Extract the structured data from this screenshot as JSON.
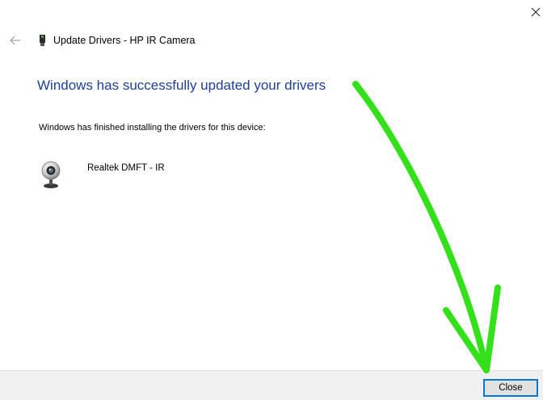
{
  "window": {
    "close_icon": "close-icon",
    "title": "Update Drivers - HP IR Camera",
    "back_icon": "back-arrow-icon",
    "device_icon": "usb-device-icon"
  },
  "main": {
    "headline": "Windows has successfully updated your drivers",
    "info_text": "Windows has finished installing the drivers for this device:",
    "driver": {
      "icon": "webcam-icon",
      "name": "Realtek DMFT - IR"
    }
  },
  "footer": {
    "close_label": "Close"
  },
  "colors": {
    "headline": "#1e3f99",
    "button_border": "#0078d7",
    "annotation_arrow": "#33e01a",
    "footer_bg": "#f0f0f0"
  }
}
